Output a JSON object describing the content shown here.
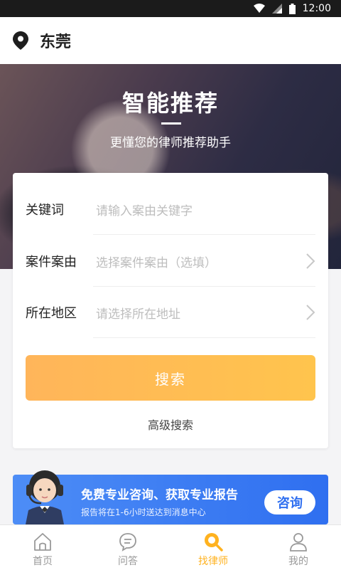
{
  "status_bar": {
    "time": "12:00"
  },
  "header": {
    "city": "东莞"
  },
  "hero": {
    "title": "智能推荐",
    "subtitle": "更懂您的律师推荐助手"
  },
  "search_form": {
    "keyword": {
      "label": "关键词",
      "placeholder": "请输入案由关键字"
    },
    "case_type": {
      "label": "案件案由",
      "placeholder": "选择案件案由（选填）"
    },
    "region": {
      "label": "所在地区",
      "placeholder": "请选择所在地址"
    },
    "search_button": "搜索",
    "advanced_link": "高级搜索"
  },
  "consult_banner": {
    "title": "免费专业咨询、获取专业报告",
    "subtitle": "报告将在1-6小时送达到消息中心",
    "button": "咨询"
  },
  "tabbar": {
    "items": [
      {
        "label": "首页",
        "icon": "home-icon"
      },
      {
        "label": "问答",
        "icon": "chat-icon"
      },
      {
        "label": "找律师",
        "icon": "search-lawyer-icon",
        "active": true
      },
      {
        "label": "我的",
        "icon": "profile-icon"
      }
    ]
  },
  "colors": {
    "accent": "#ffb21f",
    "button": "#ffbd52",
    "banner": "#3d7df3"
  }
}
